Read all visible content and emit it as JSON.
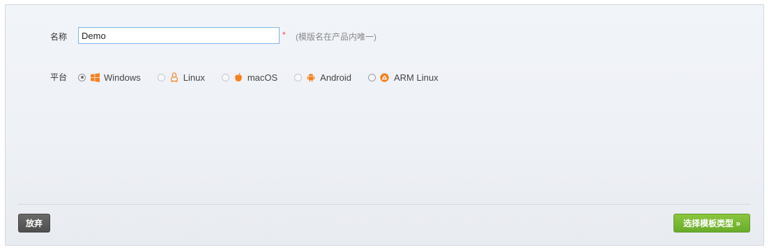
{
  "form": {
    "name_label": "名称",
    "name_value": "Demo",
    "required_mark": "*",
    "name_hint": "(模版名在产品内唯一)",
    "platform_label": "平台",
    "platforms": [
      {
        "label": "Windows",
        "icon": "windows-icon",
        "checked": true,
        "enabled": true
      },
      {
        "label": "Linux",
        "icon": "linux-tux-icon",
        "checked": false,
        "enabled": false
      },
      {
        "label": "macOS",
        "icon": "apple-icon",
        "checked": false,
        "enabled": false
      },
      {
        "label": "Android",
        "icon": "android-icon",
        "checked": false,
        "enabled": false
      },
      {
        "label": "ARM Linux",
        "icon": "arm-linux-icon",
        "checked": false,
        "enabled": true
      }
    ]
  },
  "footer": {
    "discard_label": "放弃",
    "next_label": "选择模板类型 »"
  },
  "colors": {
    "accent_orange": "#f5821f",
    "next_green": "#7ab833",
    "discard_gray": "#555555",
    "required_red": "#e8483c"
  }
}
